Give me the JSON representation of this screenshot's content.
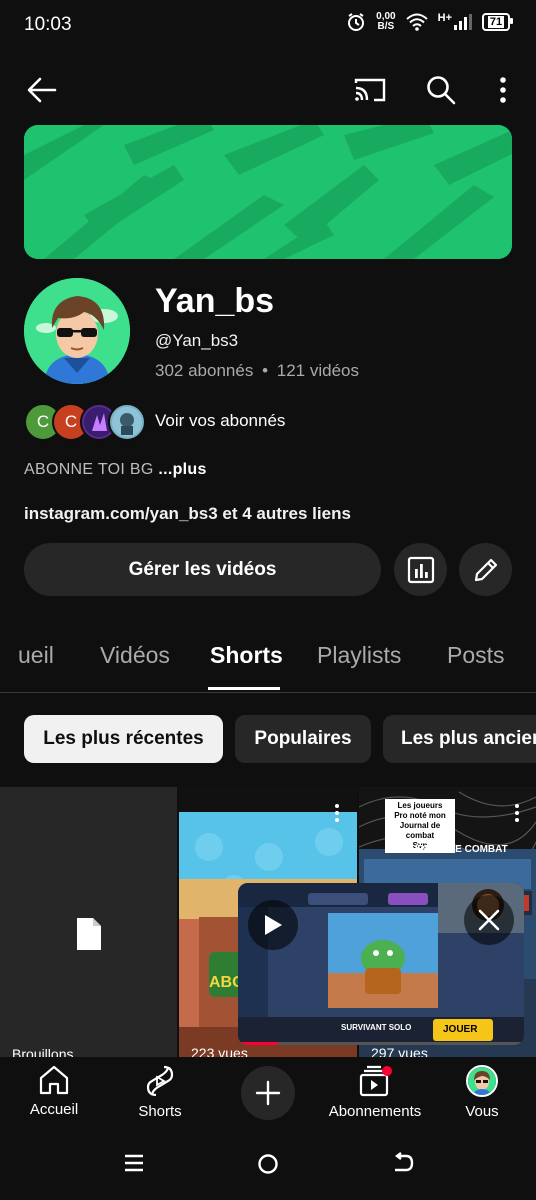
{
  "status_bar": {
    "time": "10:03",
    "net_speed_value": "0,00",
    "net_speed_unit": "B/S",
    "network": "H+",
    "battery": "71"
  },
  "top_bar": {
    "back_icon": "arrow-left-icon",
    "cast_icon": "cast-icon",
    "search_icon": "search-icon",
    "more_icon": "more-vert-icon"
  },
  "channel": {
    "name": "Yan_bs",
    "handle": "@Yan_bs3",
    "subscribers": "302 abonnés",
    "separator": "•",
    "videos": "121 vidéos",
    "subscriber_avatars": [
      "C",
      "C"
    ],
    "view_subscribers": "Voir vos abonnés",
    "description": "ABONNE TOI BG",
    "description_more": "...plus",
    "links": "instagram.com/yan_bs3 et 4 autres liens",
    "manage_videos": "Gérer les vidéos"
  },
  "tabs": [
    {
      "label": "Accueil",
      "visible_label": "ueil"
    },
    {
      "label": "Vidéos"
    },
    {
      "label": "Shorts",
      "active": true
    },
    {
      "label": "Playlists"
    },
    {
      "label": "Posts"
    }
  ],
  "chips": [
    {
      "label": "Les plus récentes",
      "active": true
    },
    {
      "label": "Populaires"
    },
    {
      "label": "Les plus ancien"
    }
  ],
  "shorts": [
    {
      "label": "Brouillons",
      "icon": "file-icon"
    },
    {
      "views": "223 vues"
    },
    {
      "views": "297 vues",
      "overlay_text": [
        "Les joueurs",
        "Pro noté mon",
        "Journal de combat",
        "Svp"
      ],
      "banner_text": "JOURNAL DE COMBAT"
    }
  ],
  "mini_player": {
    "play_icon": "play-icon",
    "close_icon": "close-icon",
    "game_text": "SURVIVANT SOLO",
    "join_button": "JOUER"
  },
  "bottom_nav": [
    {
      "label": "Accueil",
      "icon": "home-icon"
    },
    {
      "label": "Shorts",
      "icon": "shorts-icon"
    },
    {
      "label": "",
      "icon": "add-icon"
    },
    {
      "label": "Abonnements",
      "icon": "subscriptions-icon"
    },
    {
      "label": "Vous",
      "icon": "avatar-icon"
    }
  ],
  "colors": {
    "background": "#0f0f0f",
    "banner_green": "#1fc26e",
    "chip_bg": "#272727",
    "notification_dot": "#ff0033"
  }
}
